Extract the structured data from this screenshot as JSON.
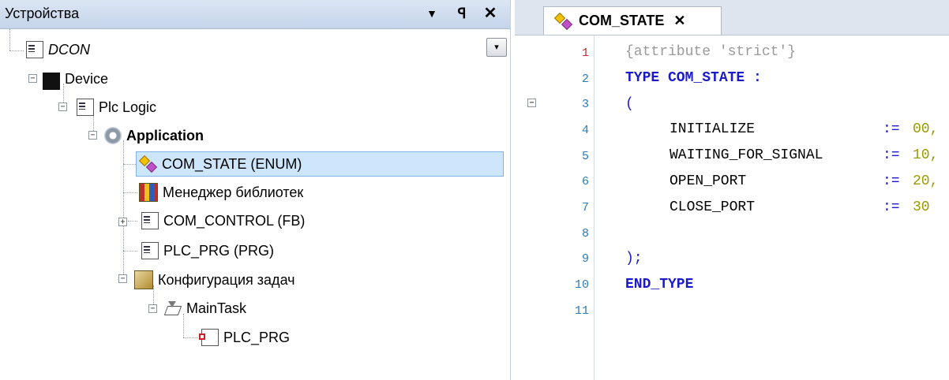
{
  "devices_panel": {
    "title": "Устройства",
    "controls": {
      "dropdown": "▼",
      "pin": "ᵖ",
      "close": "✕"
    },
    "combo_arrow": "▾",
    "tree": [
      {
        "label": "DCON",
        "icon": "project-icon",
        "italic": true
      },
      {
        "label": "Device",
        "icon": "device-icon"
      },
      {
        "label": "Plc Logic",
        "icon": "plc-logic-icon"
      },
      {
        "label": "Application",
        "icon": "application-icon",
        "bold": true
      },
      {
        "label": "COM_STATE (ENUM)",
        "icon": "enum-icon",
        "selected": true
      },
      {
        "label": "Менеджер библиотек",
        "icon": "library-manager-icon"
      },
      {
        "label": "COM_CONTROL (FB)",
        "icon": "function-block-icon"
      },
      {
        "label": "PLC_PRG (PRG)",
        "icon": "program-icon"
      },
      {
        "label": "Конфигурация задач",
        "icon": "task-config-icon"
      },
      {
        "label": "MainTask",
        "icon": "task-icon"
      },
      {
        "label": "PLC_PRG",
        "icon": "program-call-icon"
      }
    ]
  },
  "editor": {
    "tab_label": "COM_STATE",
    "tab_close": "✕",
    "line_numbers": [
      "1",
      "2",
      "3",
      "4",
      "5",
      "6",
      "7",
      "8",
      "9",
      "10",
      "11"
    ],
    "code": {
      "l1": "{attribute 'strict'}",
      "l2_kw": "TYPE COM_STATE :",
      "l3": "(",
      "l4_name": "INITIALIZE",
      "l4_op": ":=",
      "l4_val": "00,",
      "l5_name": "WAITING_FOR_SIGNAL",
      "l5_op": ":=",
      "l5_val": "10,",
      "l6_name": "OPEN_PORT",
      "l6_op": ":=",
      "l6_val": "20,",
      "l7_name": "CLOSE_PORT",
      "l7_op": ":=",
      "l7_val": "30",
      "l9": ");",
      "l10": "END_TYPE"
    },
    "fold_marker": "−"
  },
  "colors": {
    "keyword": "#1a1acc",
    "attribute": "#9a9a9a",
    "number": "#9a9a00",
    "selection": "#cde6fb"
  }
}
